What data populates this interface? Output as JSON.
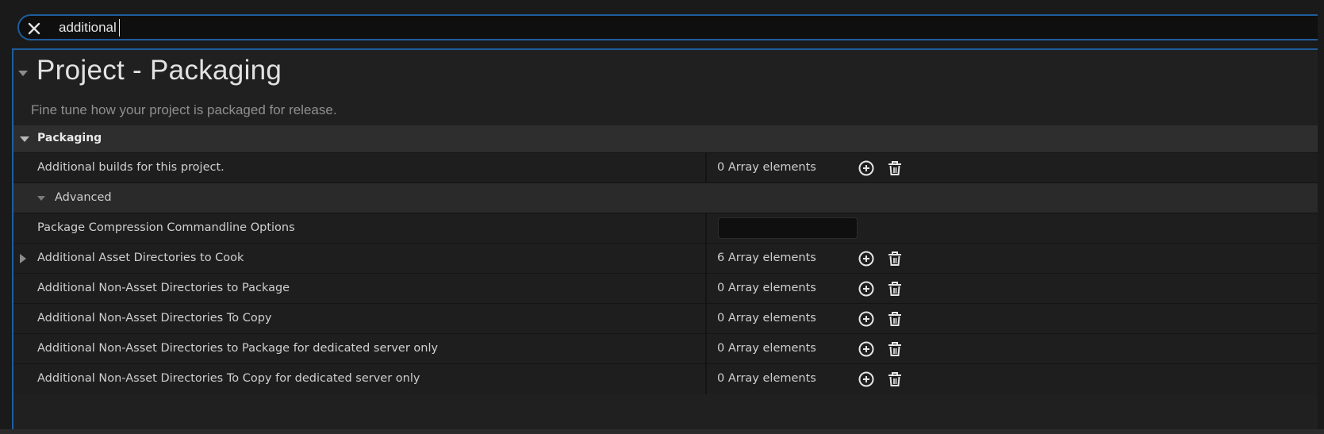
{
  "search": {
    "value": "additional"
  },
  "category": {
    "title": "Project - Packaging",
    "description": "Fine tune how your project is packaged for release."
  },
  "section": {
    "label": "Packaging"
  },
  "rows": [
    {
      "name": "Additional builds for this project.",
      "count": "0 Array elements"
    },
    {
      "name": "Advanced"
    },
    {
      "name": "Package Compression Commandline Options",
      "value": ""
    },
    {
      "name": "Additional Asset Directories to Cook",
      "count": "6 Array elements"
    },
    {
      "name": "Additional Non-Asset Directories to Package",
      "count": "0 Array elements"
    },
    {
      "name": "Additional Non-Asset Directories To Copy",
      "count": "0 Array elements"
    },
    {
      "name": "Additional Non-Asset Directories to Package for dedicated server only",
      "count": "0 Array elements"
    },
    {
      "name": "Additional Non-Asset Directories To Copy for dedicated server only",
      "count": "0 Array elements"
    }
  ],
  "icons": {
    "clear": "close-icon",
    "add": "plus-circle-icon",
    "delete": "trash-icon"
  },
  "colors": {
    "focus_border": "#1f5d9c",
    "panel_bg": "#202020",
    "section_bg": "#2e2e2e"
  }
}
